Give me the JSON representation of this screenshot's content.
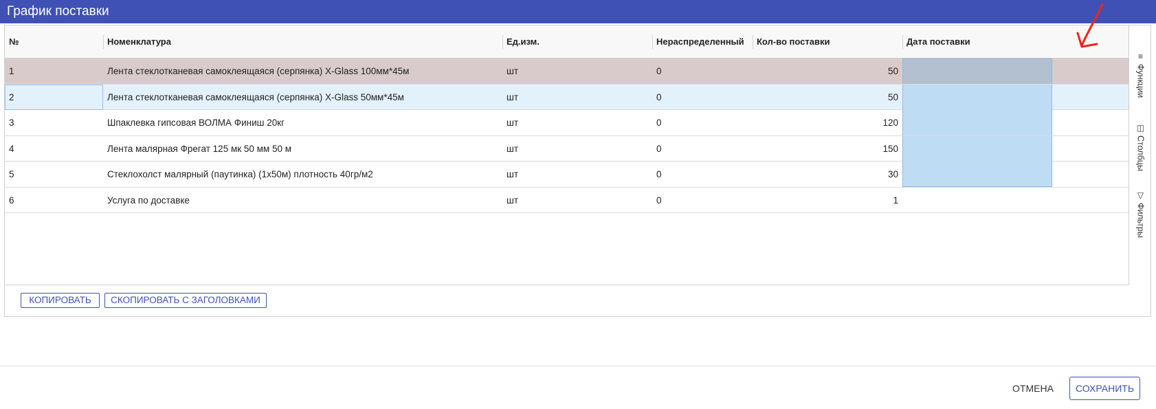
{
  "window": {
    "title": "График поставки"
  },
  "columns": [
    "№",
    "Номенклатура",
    "Ед.изм.",
    "Нераспределенный",
    "Кол-во поставки",
    "Дата поставки"
  ],
  "rows": [
    {
      "n": "1",
      "name": "Лента стеклотканевая самоклеящаяся (серпянка) X-Glass 100мм*45м",
      "unit": "шт",
      "unalloc": "0",
      "qty": "50",
      "date": ""
    },
    {
      "n": "2",
      "name": "Лента стеклотканевая самоклеящаяся (серпянка) X-Glass 50мм*45м",
      "unit": "шт",
      "unalloc": "0",
      "qty": "50",
      "date": ""
    },
    {
      "n": "3",
      "name": "Шпаклевка гипсовая ВОЛМА Финиш 20кг",
      "unit": "шт",
      "unalloc": "0",
      "qty": "120",
      "date": ""
    },
    {
      "n": "4",
      "name": "Лента малярная Фрегат 125 мк 50 мм 50 м",
      "unit": "шт",
      "unalloc": "0",
      "qty": "150",
      "date": ""
    },
    {
      "n": "5",
      "name": "Стеклохолст малярный (паутинка) (1х50м) плотность 40гр/м2",
      "unit": "шт",
      "unalloc": "0",
      "qty": "30",
      "date": ""
    },
    {
      "n": "6",
      "name": "Услуга по доставке",
      "unit": "шт",
      "unalloc": "0",
      "qty": "1",
      "date": ""
    }
  ],
  "sidebar": {
    "functions": {
      "icon": "menu-icon",
      "label": "Функции"
    },
    "columns": {
      "icon": "columns-icon",
      "label": "Столбцы"
    },
    "filters": {
      "icon": "filter-icon",
      "label": "Фильтры"
    }
  },
  "buttons": {
    "copy": "КОПИРОВАТЬ",
    "copy_headers": "СКОПИРОВАТЬ С ЗАГОЛОВКАМИ",
    "cancel": "ОТМЕНА",
    "save": "СОХРАНИТЬ"
  },
  "colors": {
    "accent": "#3f51b5",
    "selected_row": "#d9cbcb",
    "hover_row": "#e3f1fb",
    "range_fill": "#bfdcf5",
    "annotation": "#e8261c"
  }
}
